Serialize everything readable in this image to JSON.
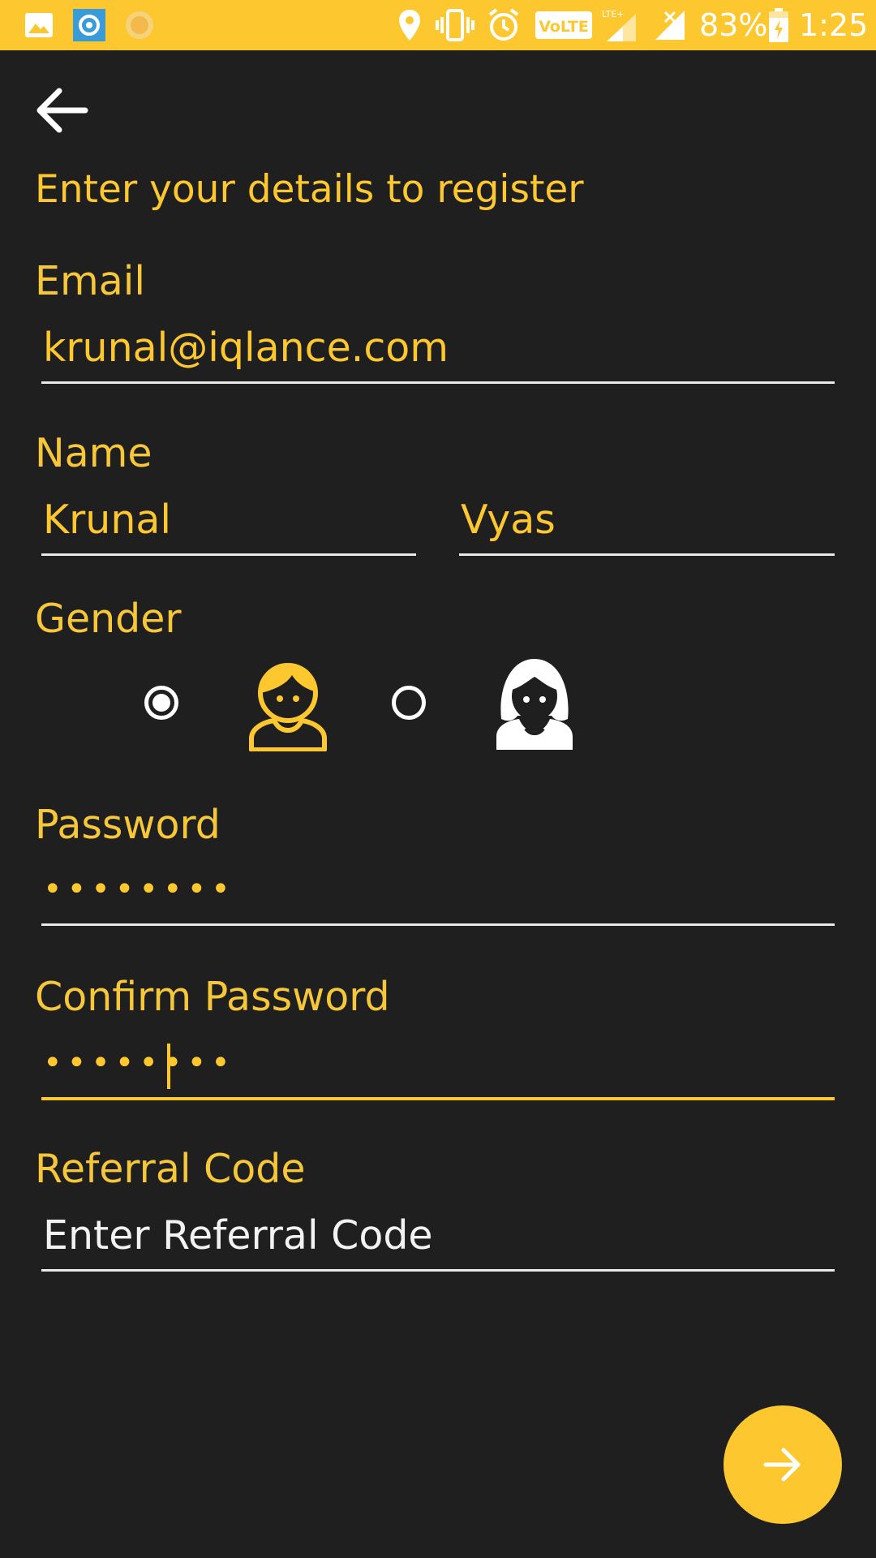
{
  "status_bar": {
    "battery": "83%",
    "time": "1:25",
    "network_badge": "VoLTE",
    "lte_label": "LTE+",
    "icons": [
      "gallery-icon",
      "photo-app-icon",
      "sun-app-icon",
      "location-icon",
      "vibrate-icon",
      "alarm-icon",
      "volte-icon",
      "lte-signal-icon",
      "signal-icon",
      "battery-charging-icon"
    ]
  },
  "header": {
    "back_icon": "back-arrow-icon"
  },
  "form": {
    "title": "Enter your details to register",
    "email": {
      "label": "Email",
      "value": "krunal@iqlance.com"
    },
    "name": {
      "label": "Name",
      "first": "Krunal",
      "last": "Vyas"
    },
    "gender": {
      "label": "Gender",
      "selected": "male",
      "options": [
        "male",
        "female"
      ]
    },
    "password": {
      "label": "Password",
      "value": "••••••••"
    },
    "confirm_password": {
      "label": "Confirm Password",
      "value": "••••••••"
    },
    "referral": {
      "label": "Referral Code",
      "placeholder": "Enter Referral Code"
    }
  },
  "fab": {
    "icon": "arrow-right-icon"
  },
  "colors": {
    "accent": "#fdc82f",
    "background": "#1f1f1f",
    "underline": "#e9e9e9"
  }
}
